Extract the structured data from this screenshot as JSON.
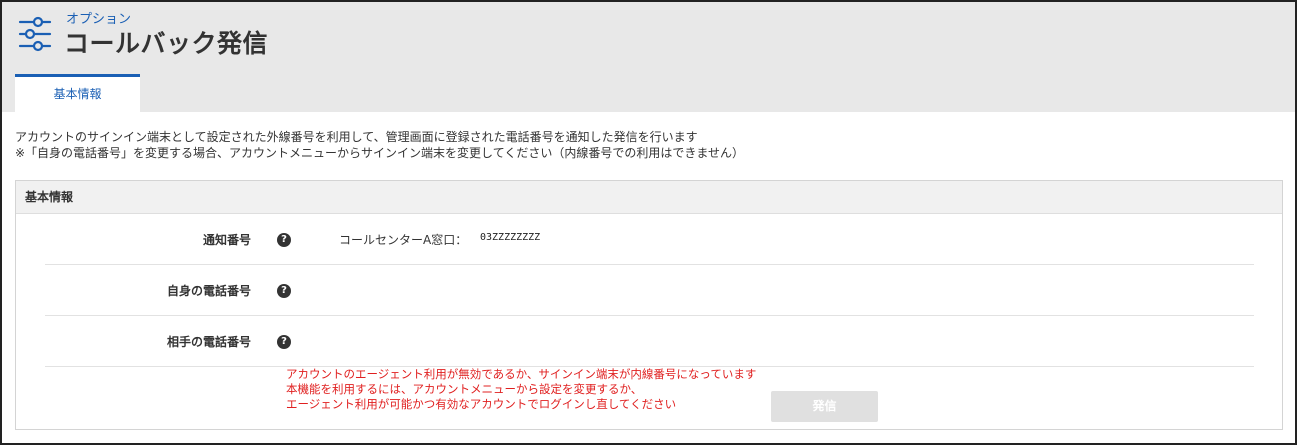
{
  "header": {
    "subtitle": "オプション",
    "title": "コールバック発信",
    "icon": "sliders-icon"
  },
  "tabs": [
    {
      "label": "基本情報",
      "active": true
    }
  ],
  "description": {
    "line1": "アカウントのサインイン端末として設定された外線番号を利用して、管理画面に登録された電話番号を通知した発信を行います",
    "line2": "※「自身の電話番号」を変更する場合、アカウントメニューからサインイン端末を変更してください（内線番号での利用はできません）"
  },
  "section": {
    "title": "基本情報",
    "rows": [
      {
        "label": "通知番号",
        "value_label": "コールセンターA窓口：",
        "value": "03ZZZZZZZZ"
      },
      {
        "label": "自身の電話番号",
        "value_label": "",
        "value": ""
      },
      {
        "label": "相手の電話番号",
        "value_label": "",
        "value": ""
      }
    ],
    "error": {
      "line1": "アカウントのエージェント利用が無効であるか、サインイン端末が内線番号になっています",
      "line2": "本機能を利用するには、アカウントメニューから設定を変更するか、",
      "line3": "エージェント利用が可能かつ有効なアカウントでログインし直してください"
    },
    "button_label": "発信",
    "help_glyph": "?"
  },
  "colors": {
    "accent": "#1a5fb4",
    "error": "#e02020",
    "header_bg": "#e8e8e8",
    "button_disabled": "#e0e0e0"
  }
}
